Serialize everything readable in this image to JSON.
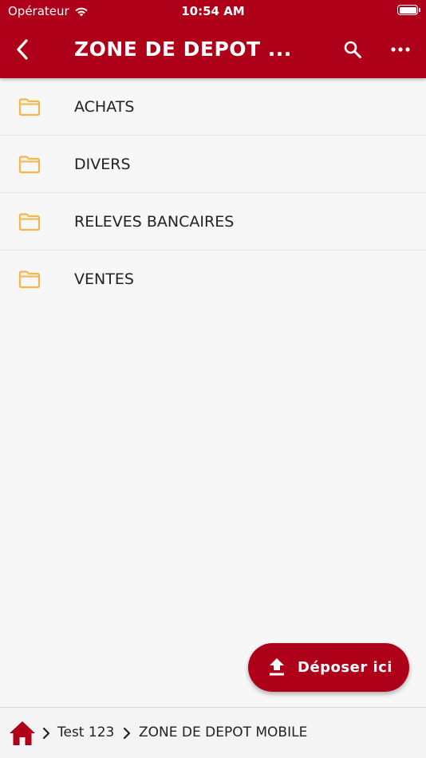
{
  "status_bar": {
    "carrier": "Opérateur",
    "time": "10:54 AM",
    "wifi_icon": "wifi-icon",
    "battery_icon": "battery-icon"
  },
  "nav": {
    "title": "ZONE DE DEPOT ...",
    "back_icon": "chevron-left-icon",
    "search_icon": "search-icon",
    "more_icon": "more-horizontal-icon"
  },
  "folders": [
    {
      "label": "ACHATS",
      "icon": "folder-icon"
    },
    {
      "label": "DIVERS",
      "icon": "folder-icon"
    },
    {
      "label": "RELEVES BANCAIRES",
      "icon": "folder-icon"
    },
    {
      "label": "VENTES",
      "icon": "folder-icon"
    }
  ],
  "upload": {
    "label": "Déposer ici",
    "icon": "upload-icon"
  },
  "breadcrumb": {
    "home_icon": "home-icon",
    "separator_icon": "chevron-right-icon",
    "items": [
      "Test 123",
      "ZONE DE DEPOT MOBILE"
    ]
  },
  "colors": {
    "primary": "#ae0019",
    "folder": "#f5b64a",
    "background": "#f7f7f7"
  }
}
